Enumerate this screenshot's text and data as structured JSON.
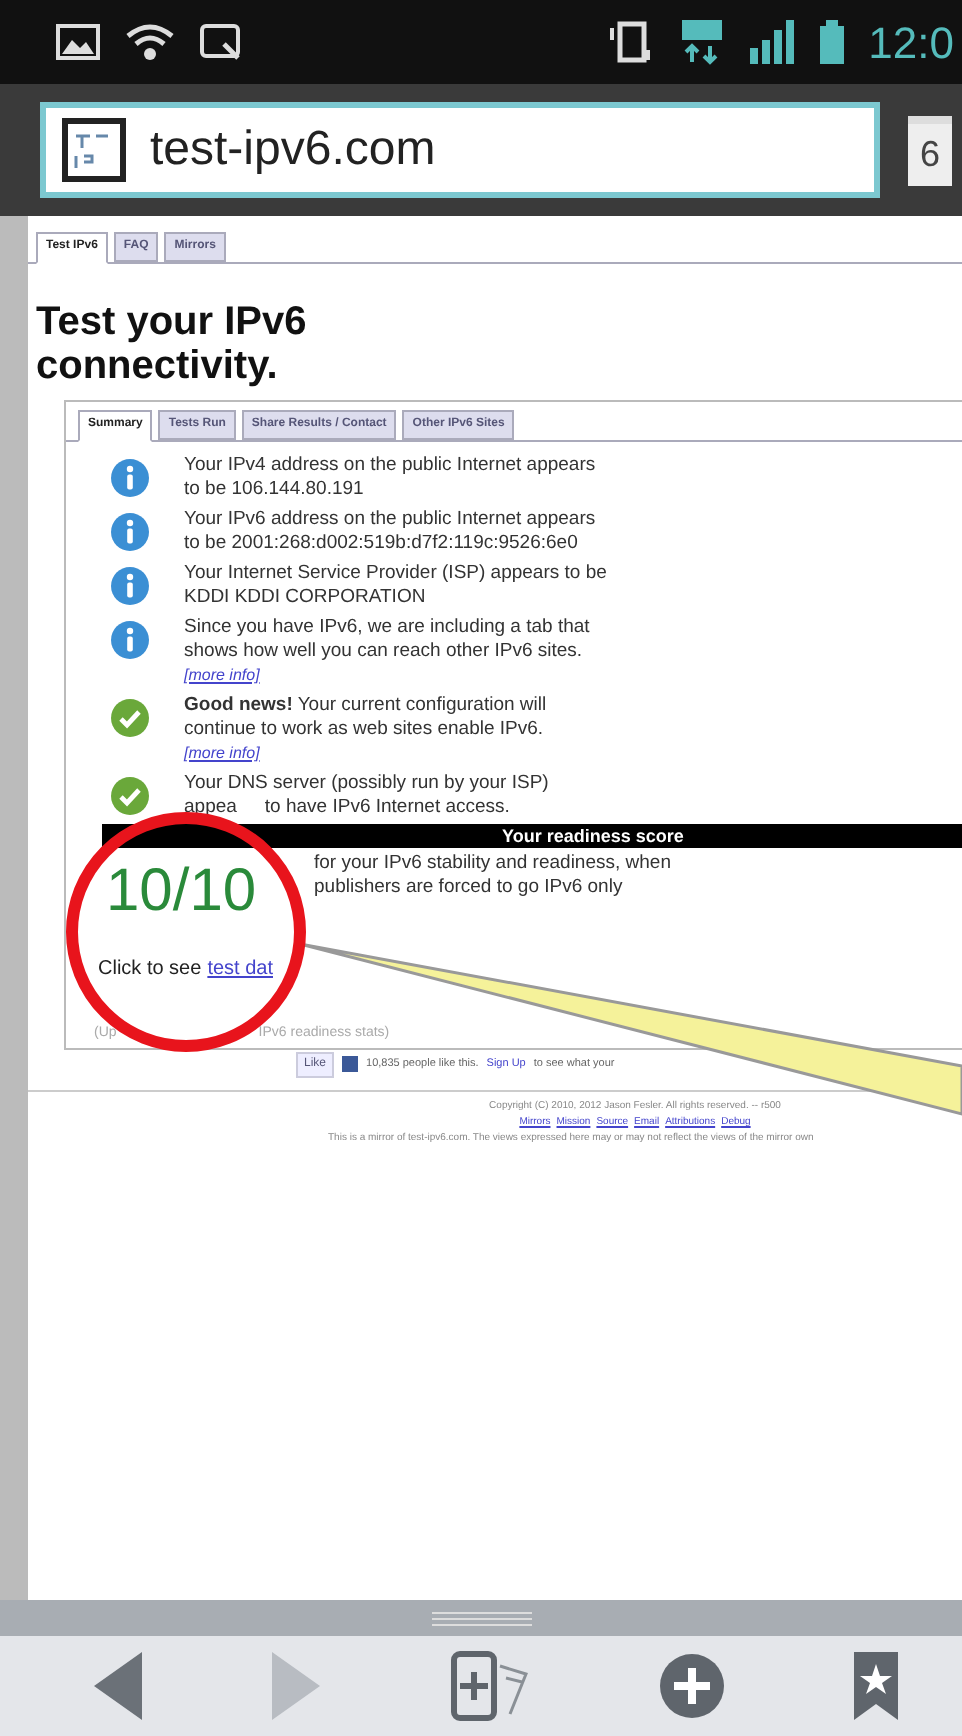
{
  "status_bar": {
    "time": "12:0"
  },
  "address_bar": {
    "url": "test-ipv6.com",
    "tab_count": "6"
  },
  "site_tabs": [
    {
      "label": "Test IPv6",
      "selected": true
    },
    {
      "label": "FAQ",
      "selected": false
    },
    {
      "label": "Mirrors",
      "selected": false
    }
  ],
  "heading": "Test your IPv6 connectivity.",
  "result_tabs": [
    {
      "label": "Summary",
      "selected": true
    },
    {
      "label": "Tests Run",
      "selected": false
    },
    {
      "label": "Share Results / Contact",
      "selected": false
    },
    {
      "label": "Other IPv6 Sites",
      "selected": false
    }
  ],
  "results": [
    {
      "kind": "info",
      "text": "Your IPv4 address on the public Internet appears to be 106.144.80.191"
    },
    {
      "kind": "info",
      "text": "Your IPv6 address on the public Internet appears to be 2001:268:d002:519b:d7f2:119c:9526:6e0"
    },
    {
      "kind": "info",
      "text": "Your Internet Service Provider (ISP) appears to be KDDI KDDI CORPORATION"
    },
    {
      "kind": "info",
      "text": "Since you have IPv6, we are including a tab that shows how well you can reach other IPv6 sites.",
      "link": "[more info]"
    },
    {
      "kind": "ok",
      "text": "**Good news!** Your current configuration will continue to work as web sites enable IPv6.",
      "link": "[more info]"
    },
    {
      "kind": "ok",
      "text": "Your DNS server (possibly run by your ISP)",
      "text_line2_start": "appea",
      "text_line2_end": "to have IPv6 Internet access."
    }
  ],
  "readiness": {
    "title": "Your readiness score",
    "score": "10/10",
    "description": "for your IPv6 stability and readiness, when publishers are forced to go IPv6 only",
    "click_label": "Click to see",
    "click_link": "test dat",
    "updated_start": "(Up",
    "updated_end": "IPv6 readiness stats)"
  },
  "social": {
    "like_button": "Like",
    "text": "10,835 people like this.",
    "signup_link": "Sign Up",
    "text_after": "to see what your"
  },
  "footer": {
    "copyright": "Copyright (C) 2010, 2012 Jason Fesler. All rights reserved. -- r500",
    "links": [
      "Mirrors",
      "Mission",
      "Source",
      "Email",
      "Attributions",
      "Debug"
    ],
    "note": "This is a mirror of test-ipv6.com. The views expressed here may or may not reflect the views of the mirror own"
  }
}
